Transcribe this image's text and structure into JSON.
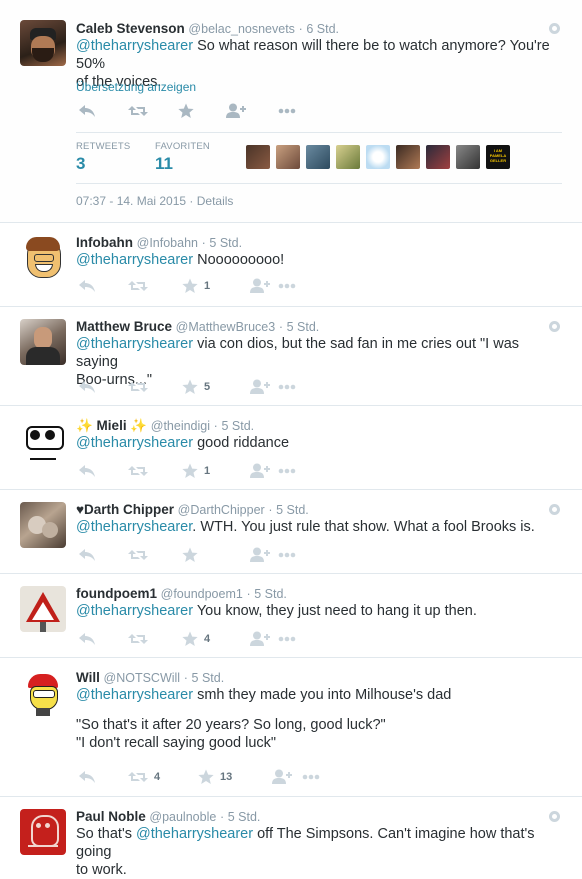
{
  "detail": {
    "name": "Caleb Stevenson",
    "handle": "@belac_nosnevets",
    "time": "6 Std.",
    "mention": "@theharryshearer",
    "text": " So what reason will there be to watch anymore? You're 50%",
    "text2": "of the voices.",
    "translate": "Übersetzung anzeigen",
    "retweets_label": "RETWEETS",
    "retweets_value": "3",
    "favorites_label": "FAVORITEN",
    "favorites_value": "11",
    "favoriters_last_label": "I AM PAMELA GELLER",
    "timestamp": "07:37 - 14. Mai 2015",
    "details_link": "Details"
  },
  "replies": [
    {
      "name": "Infobahn",
      "handle": "@Infobahn",
      "time": "5 Std.",
      "mention": "@theharryshearer",
      "text": " Nooooooooo!",
      "favorites": "1"
    },
    {
      "name": "Matthew Bruce",
      "handle": "@MatthewBruce3",
      "time": "5 Std.",
      "mention": "@theharryshearer",
      "text": " via con dios, but the sad fan in me cries out \"I was saying",
      "text2": "Boo-urns...\"",
      "favorites": "5"
    },
    {
      "name": "✨ Mieli ✨",
      "handle": "@theindigi",
      "time": "5 Std.",
      "mention": "@theharryshearer",
      "text": " good riddance",
      "favorites": "1"
    },
    {
      "name": "♥Darth Chipper",
      "handle": "@DarthChipper",
      "time": "5 Std.",
      "mention": "@theharryshearer",
      "text": ". WTH. You just rule that show. What a fool Brooks is."
    },
    {
      "name": "foundpoem1",
      "handle": "@foundpoem1",
      "time": "5 Std.",
      "mention": "@theharryshearer",
      "text": " You know, they just need to hang it up then.",
      "favorites": "4"
    },
    {
      "name": "Will",
      "handle": "@NOTSCWill",
      "time": "5 Std.",
      "mention": "@theharryshearer",
      "text": " smh they made you into Milhouse's dad",
      "text2": "\"So that's it after 20 years? So long, good luck?\"",
      "text3": "\"I don't recall saying good luck\"",
      "retweets": "4",
      "favorites": "13"
    },
    {
      "name": "Paul Noble",
      "handle": "@paulnoble",
      "time": "5 Std.",
      "prefix": "So that's ",
      "mention": "@theharryshearer",
      "text": " off The Simpsons. Can't imagine how that's going",
      "text2": "to work."
    }
  ],
  "icons": [
    "reply-icon",
    "retweet-icon",
    "favorite-icon",
    "follow-icon",
    "more-icon",
    "gear-icon"
  ],
  "colors": {
    "link": "#2a8ba8",
    "meta": "#8899a6",
    "border": "#e1e8ed",
    "icon": "#aab8c2"
  }
}
